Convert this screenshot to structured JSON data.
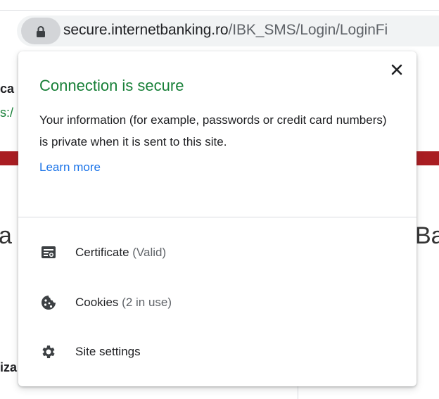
{
  "address_bar": {
    "domain": "secure.internetbanking.ro",
    "path": "/IBK_SMS/Login/LoginFi"
  },
  "background": {
    "text_line1": "ca",
    "text_line2": "s:/",
    "heading_left": "a",
    "heading_right": "Ba",
    "text_bottom": "iza"
  },
  "popup": {
    "title": "Connection is secure",
    "description": "Your information (for example, passwords or credit card numbers) is private when it is sent to this site.",
    "learn_more": "Learn more",
    "items": [
      {
        "label": "Certificate",
        "detail": "(Valid)",
        "icon": "certificate-icon"
      },
      {
        "label": "Cookies",
        "detail": "(2 in use)",
        "icon": "cookie-icon"
      },
      {
        "label": "Site settings",
        "detail": "",
        "icon": "gear-icon"
      }
    ]
  },
  "colors": {
    "secure_green": "#188038",
    "link_blue": "#1a73e8",
    "brand_red": "#a91d22"
  }
}
